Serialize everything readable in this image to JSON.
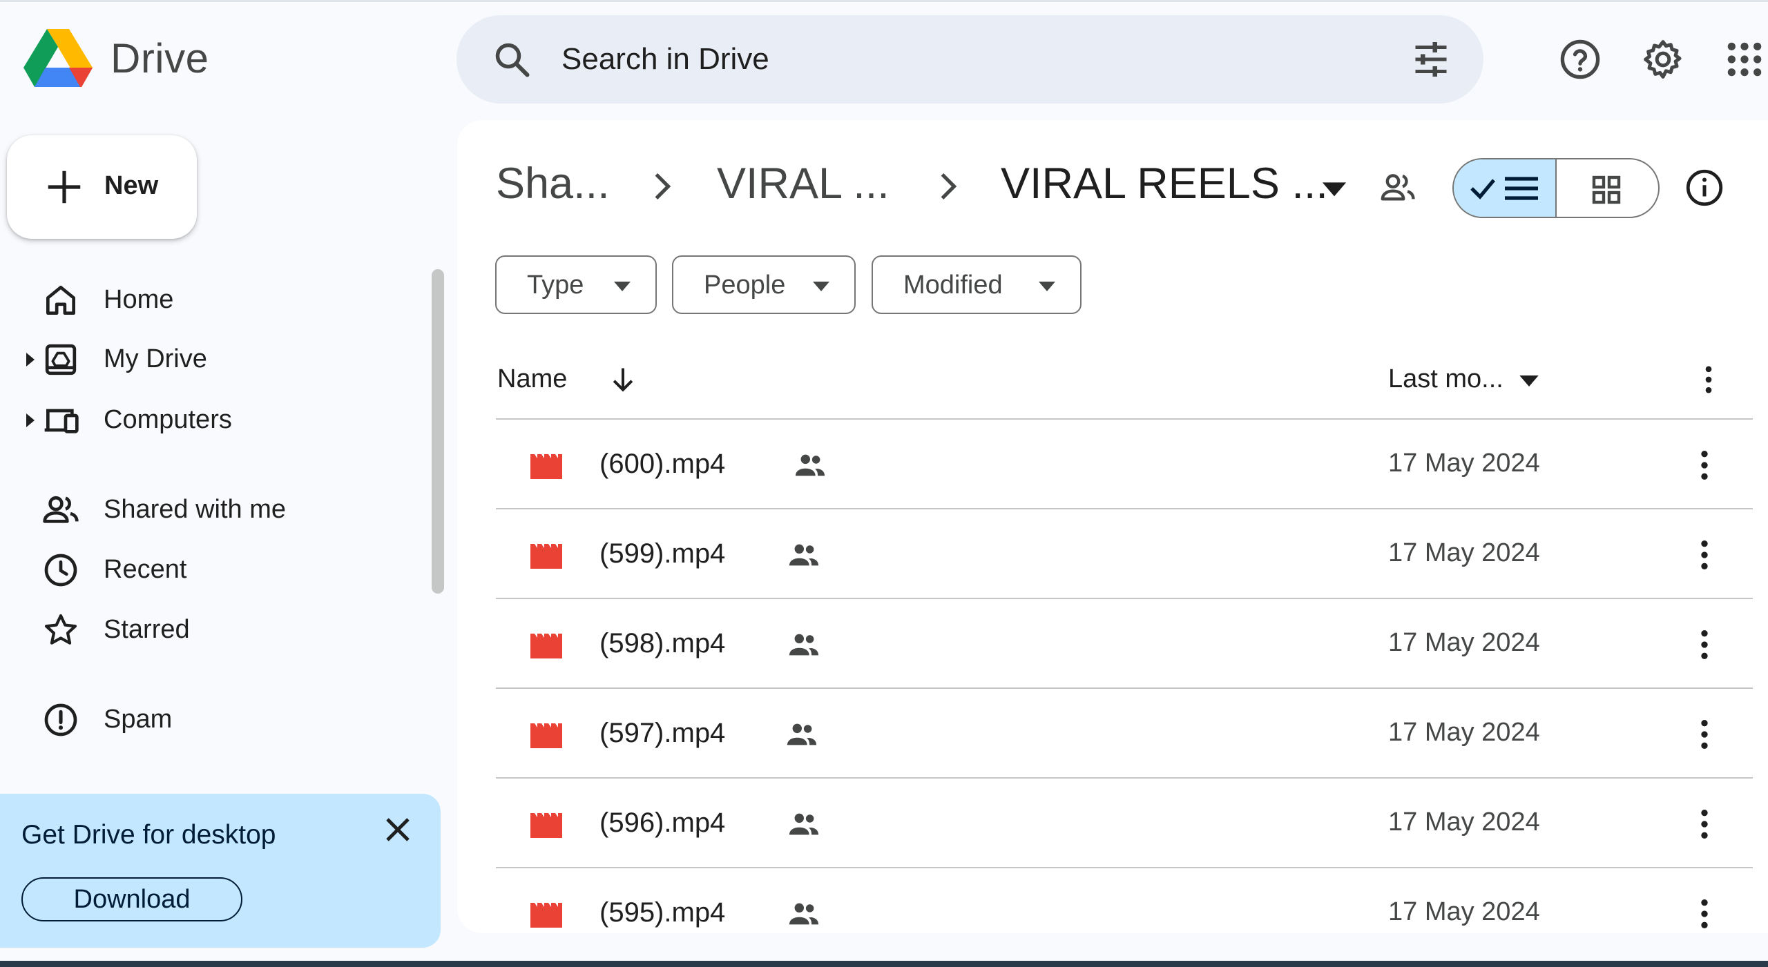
{
  "header": {
    "brand": "Drive",
    "search": {
      "placeholder": "Search in Drive"
    },
    "icons": [
      "search-icon",
      "tune-icon",
      "help-icon",
      "settings-icon",
      "apps-icon"
    ]
  },
  "sidebar": {
    "new_label": "New",
    "items": [
      {
        "label": "Home",
        "icon": "home-icon",
        "expandable": false
      },
      {
        "label": "My Drive",
        "icon": "my-drive-icon",
        "expandable": true
      },
      {
        "label": "Computers",
        "icon": "computers-icon",
        "expandable": true
      },
      {
        "label": "Shared with me",
        "icon": "people-icon",
        "expandable": false
      },
      {
        "label": "Recent",
        "icon": "clock-icon",
        "expandable": false
      },
      {
        "label": "Starred",
        "icon": "star-icon",
        "expandable": false
      },
      {
        "label": "Spam",
        "icon": "spam-icon",
        "expandable": false
      }
    ],
    "promo": {
      "title": "Get Drive for desktop",
      "download_label": "Download"
    }
  },
  "breadcrumb": {
    "items": [
      "Sha...",
      "VIRAL ...",
      "VIRAL REELS ..."
    ]
  },
  "filters": {
    "chips": [
      "Type",
      "People",
      "Modified"
    ]
  },
  "list": {
    "columns": {
      "name": "Name",
      "modified": "Last mo..."
    },
    "rows": [
      {
        "name": "(600).mp4",
        "modified": "17 May 2024",
        "shared": true
      },
      {
        "name": "(599).mp4",
        "modified": "17 May 2024",
        "shared": true
      },
      {
        "name": "(598).mp4",
        "modified": "17 May 2024",
        "shared": true
      },
      {
        "name": "(597).mp4",
        "modified": "17 May 2024",
        "shared": true
      },
      {
        "name": "(596).mp4",
        "modified": "17 May 2024",
        "shared": true
      },
      {
        "name": "(595).mp4",
        "modified": "17 May 2024",
        "shared": true
      }
    ]
  },
  "colors": {
    "background": "#f8fafd",
    "search_bg": "#e9eef6",
    "active_toggle": "#c2e7ff",
    "promo_bg": "#c2e7ff",
    "video_icon": "#ea4335"
  }
}
